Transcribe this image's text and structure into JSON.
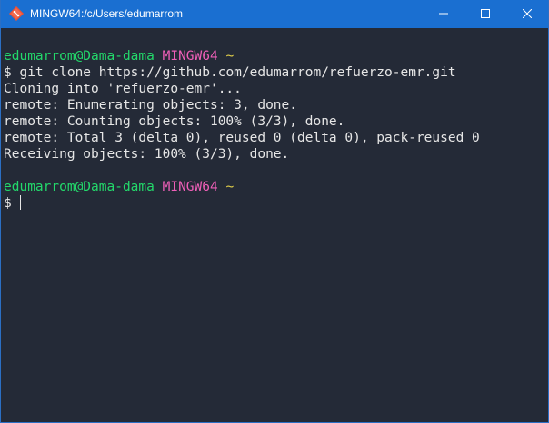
{
  "window": {
    "title": "MINGW64:/c/Users/edumarrom"
  },
  "terminal": {
    "prompt1": {
      "user_host": "edumarrom@Dama-dama",
      "env": "MINGW64",
      "path": "~"
    },
    "command_line": {
      "symbol": "$",
      "command": "git clone https://github.com/edumarrom/refuerzo-emr.git"
    },
    "output": [
      "Cloning into 'refuerzo-emr'...",
      "remote: Enumerating objects: 3, done.",
      "remote: Counting objects: 100% (3/3), done.",
      "remote: Total 3 (delta 0), reused 0 (delta 0), pack-reused 0",
      "Receiving objects: 100% (3/3), done."
    ],
    "prompt2": {
      "user_host": "edumarrom@Dama-dama",
      "env": "MINGW64",
      "path": "~"
    },
    "current_input": {
      "symbol": "$",
      "text": ""
    }
  },
  "colors": {
    "titlebar": "#1a6fd1",
    "background": "#242a37",
    "user_host": "#23d96b",
    "env": "#ef5fb8",
    "path": "#e3d04a",
    "text": "#e6e6e6"
  },
  "icons": {
    "app": "git-bash-diamond-icon",
    "minimize": "minimize-icon",
    "maximize": "maximize-icon",
    "close": "close-icon"
  }
}
